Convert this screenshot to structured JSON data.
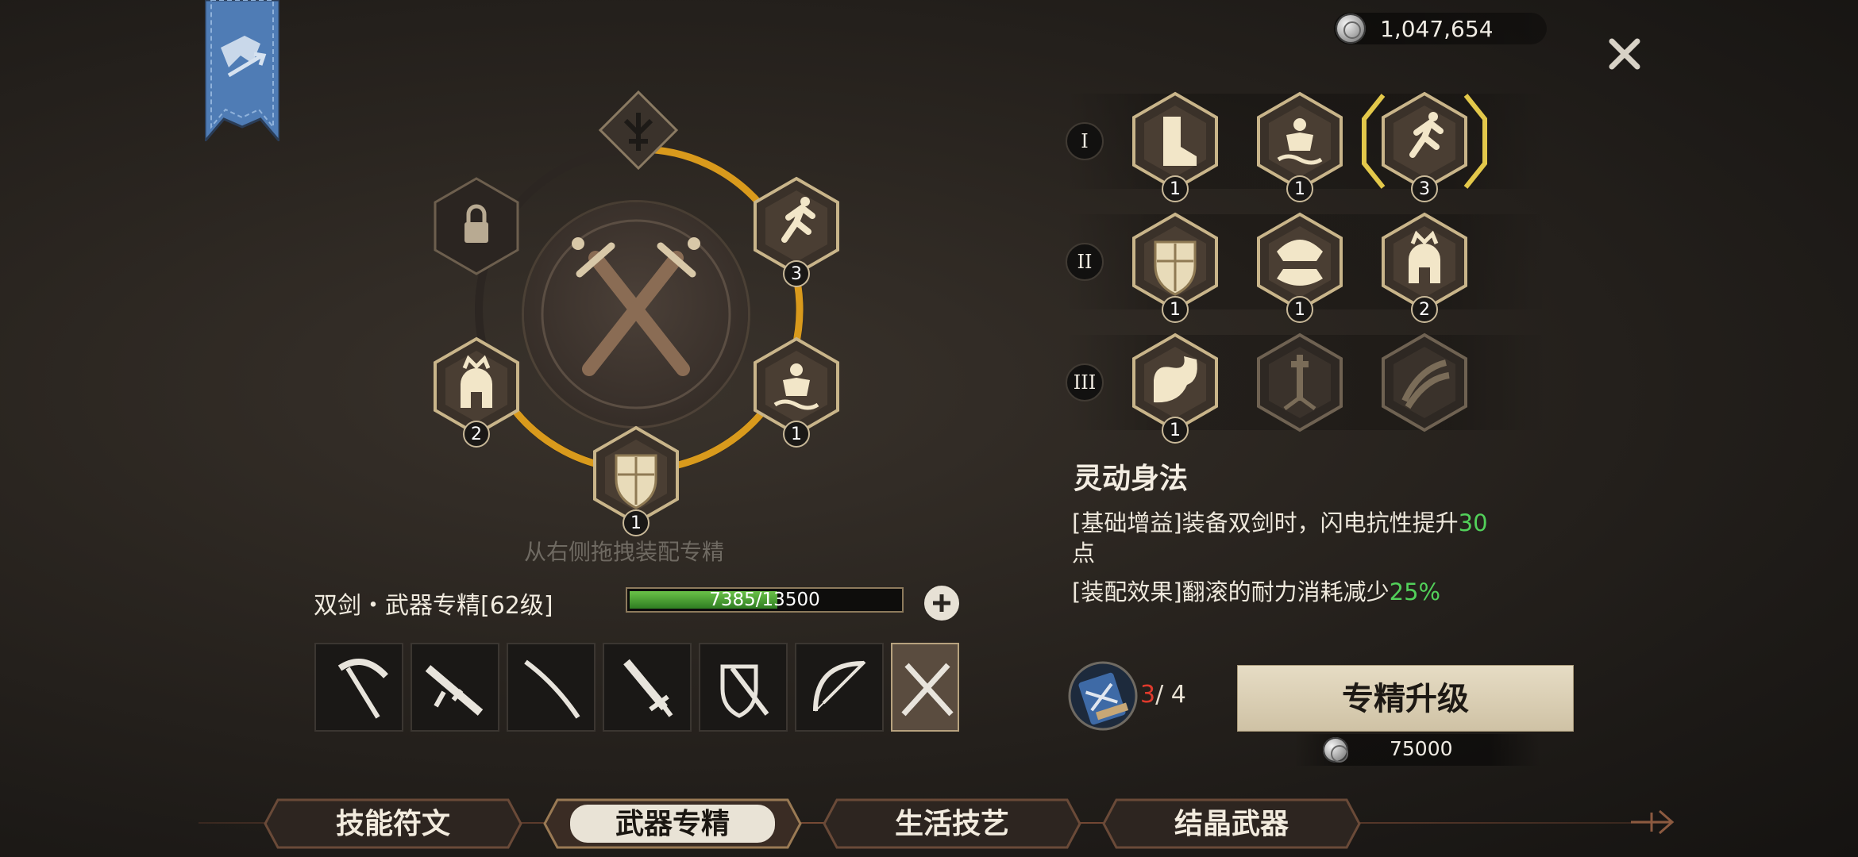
{
  "header": {
    "currency_value": "1,047,654",
    "close_label": "×"
  },
  "wheel": {
    "drag_hint": "从右侧拖拽装配专精",
    "slots": [
      {
        "name": "lock",
        "badge": ""
      },
      {
        "name": "sprint",
        "badge": "3"
      },
      {
        "name": "warrior-helmet",
        "badge": "2"
      },
      {
        "name": "swimmer",
        "badge": "1"
      },
      {
        "name": "shield",
        "badge": "1"
      }
    ]
  },
  "weapon": {
    "title": "双剑・武器专精[62级]",
    "xp_text": "7385/13500",
    "xp_fraction": 0.547,
    "categories": [
      "scythe",
      "rifle",
      "katana",
      "dagger",
      "shield-sword",
      "bow",
      "dual-swords"
    ],
    "active_index": 6
  },
  "tiers": {
    "rows": [
      {
        "roman": "I",
        "skills": [
          {
            "icon": "boot-icon",
            "badge": "1"
          },
          {
            "icon": "swimmer-icon",
            "badge": "1"
          },
          {
            "icon": "sprint-icon",
            "badge": "3",
            "selected": true
          }
        ]
      },
      {
        "roman": "II",
        "skills": [
          {
            "icon": "shield-icon",
            "badge": "1"
          },
          {
            "icon": "beast-jaw-icon",
            "badge": "1"
          },
          {
            "icon": "warrior-helmet-icon",
            "badge": "2"
          }
        ]
      },
      {
        "roman": "III",
        "skills": [
          {
            "icon": "flexed-arm-icon",
            "badge": "1"
          },
          {
            "icon": "sword-strike-icon",
            "badge": "",
            "locked": true
          },
          {
            "icon": "claw-icon",
            "badge": "",
            "locked": true
          }
        ]
      }
    ]
  },
  "detail": {
    "name": "灵动身法",
    "line1_prefix": "[基础增益]装备双剑时，闪电抗性提升",
    "line1_value": "30",
    "line1_suffix": "点",
    "line2_prefix": "[装配效果]翻滚的耐力消耗减少",
    "line2_value": "25%"
  },
  "upgrade": {
    "have": "3",
    "need": "/ 4",
    "button_label": "专精升级",
    "cost": "75000"
  },
  "bottom_tabs": [
    {
      "label": "技能符文",
      "active": false
    },
    {
      "label": "武器专精",
      "active": true
    },
    {
      "label": "生活技艺",
      "active": false
    },
    {
      "label": "结晶武器",
      "active": false
    }
  ],
  "colors": {
    "ring": "#d99a1c",
    "green": "#52d05a",
    "red": "#e03a2c",
    "banner": "#4f7cb5"
  }
}
